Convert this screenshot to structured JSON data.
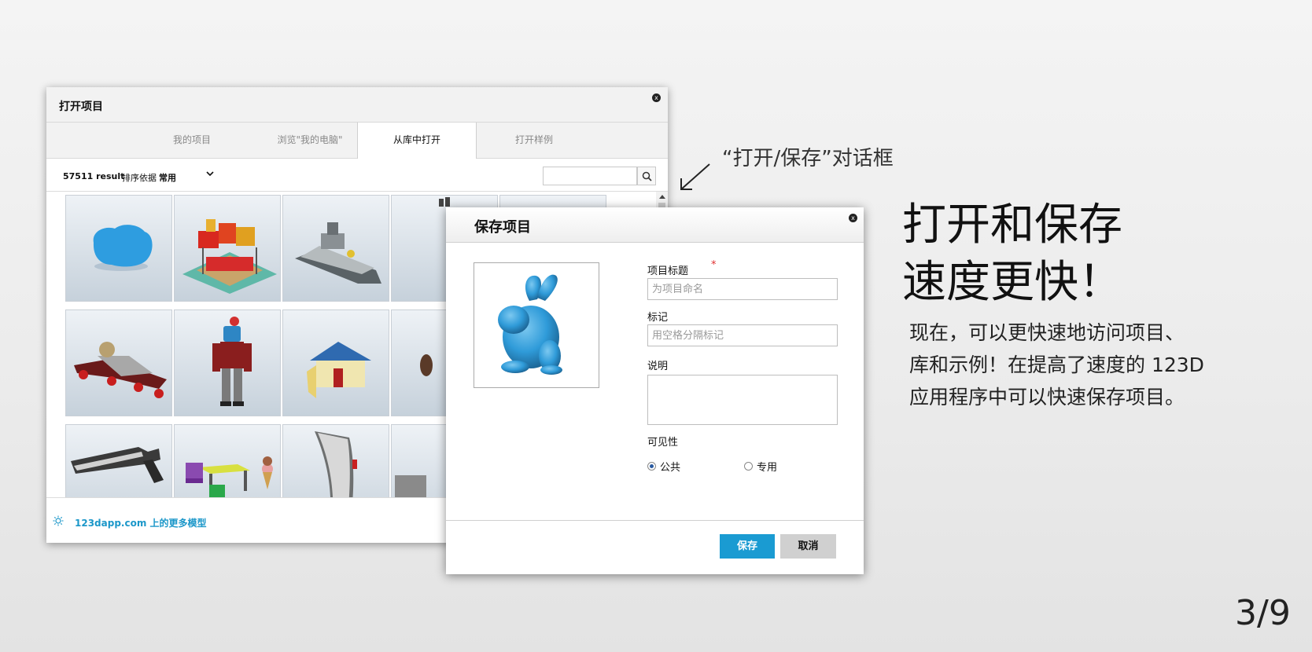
{
  "open_dialog": {
    "title": "打开项目",
    "close_glyph": "x",
    "tabs": [
      {
        "label": "我的项目",
        "active": false
      },
      {
        "label": "浏览\"我的电脑\"",
        "active": false
      },
      {
        "label": "从库中打开",
        "active": true
      },
      {
        "label": "打开样例",
        "active": false
      }
    ],
    "result_count": "57511 result",
    "sort_label": "排序依据",
    "sort_value": "常用",
    "search_placeholder": "",
    "thumbnails": [
      "blob",
      "amusement-ride",
      "ship",
      "model-4",
      "model-5",
      "vehicle",
      "robot",
      "hut",
      "model-9",
      "gun",
      "furniture-icecream",
      "blade",
      "model-13"
    ],
    "footer_link": "123dapp.com 上的更多模型"
  },
  "save_dialog": {
    "title": "保存项目",
    "close_glyph": "x",
    "preview_icon": "bunny-model",
    "title_label": "项目标题",
    "required_mark": "*",
    "title_placeholder": "为项目命名",
    "tags_label": "标记",
    "tags_placeholder": "用空格分隔标记",
    "description_label": "说明",
    "visibility_label": "可见性",
    "visibility_options": [
      {
        "label": "公共",
        "checked": true
      },
      {
        "label": "专用",
        "checked": false
      }
    ],
    "save_button": "保存",
    "cancel_button": "取消"
  },
  "annotation": {
    "callout": "“打开/保存”对话框",
    "headline_line1": "打开和保存",
    "headline_line2": "速度更快！",
    "description_line1": "现在，可以更快速地访问项目、",
    "description_line2": "库和示例！在提高了速度的 123D",
    "description_line3": "应用程序中可以快速保存项目。"
  },
  "page_number": "3/9",
  "colors": {
    "accent_blue": "#1a9bd2",
    "link_blue": "#1b97c9",
    "required_red": "#e03030",
    "bunny_blue": "#2f9bd9"
  }
}
